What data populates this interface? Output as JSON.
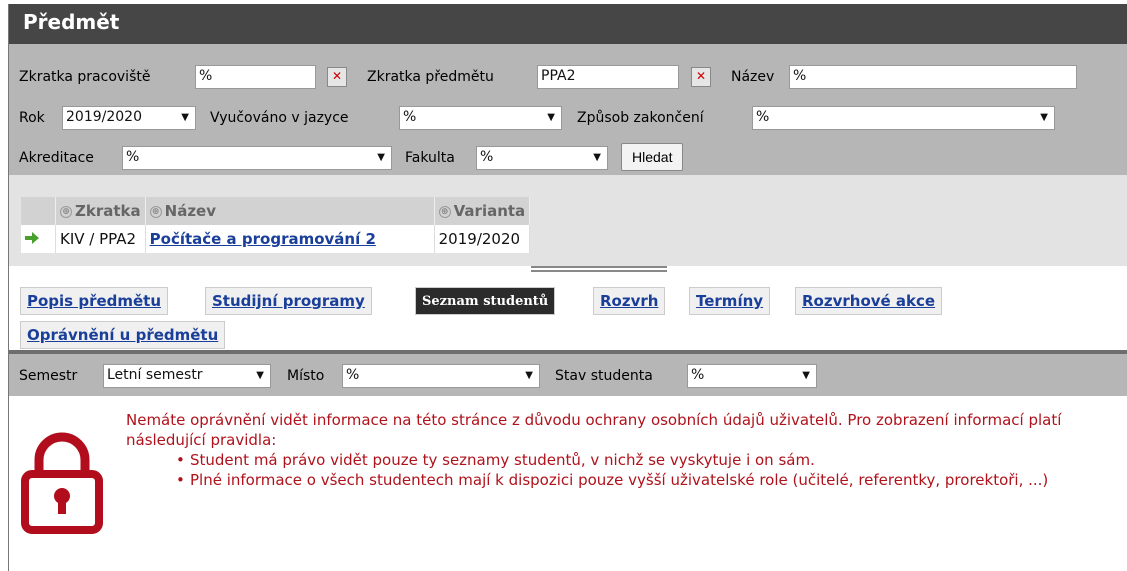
{
  "header": {
    "title": "Předmět"
  },
  "filters": {
    "zkratka_pracoviste_label": "Zkratka pracoviště",
    "zkratka_pracoviste_value": "%",
    "zkratka_predmetu_label": "Zkratka předmětu",
    "zkratka_predmetu_value": "PPA2",
    "nazev_label": "Název",
    "nazev_value": "%",
    "rok_label": "Rok",
    "rok_value": "2019/2020",
    "jazyk_label": "Vyučováno v jazyce",
    "jazyk_value": "%",
    "zakonceni_label": "Způsob zakončení",
    "zakonceni_value": "%",
    "akreditace_label": "Akreditace",
    "akreditace_value": "%",
    "fakulta_label": "Fakulta",
    "fakulta_value": "%",
    "search_button": "Hledat",
    "dropdown_arrow": "▼",
    "clear_icon": "✕"
  },
  "results": {
    "columns": [
      "Zkratka",
      "Název",
      "Varianta"
    ],
    "rows": [
      {
        "zkratka": "KIV / PPA2",
        "nazev": "Počítače a programování 2",
        "varianta": "2019/2020"
      }
    ],
    "row_marker_icon": "green-arrow-right-icon",
    "sort_icon_glyph": "⊕"
  },
  "tabs": [
    {
      "label": "Popis předmětu"
    },
    {
      "label": "Studijní programy"
    },
    {
      "label": "Seznam studentů",
      "active": true
    },
    {
      "label": "Rozvrh"
    },
    {
      "label": "Termíny"
    },
    {
      "label": "Rozvrhové akce"
    },
    {
      "label": "Oprávnění u předmětu"
    }
  ],
  "subfilter": {
    "semestr_label": "Semestr",
    "semestr_value": "Letní semestr",
    "misto_label": "Místo",
    "misto_value": "%",
    "stav_label": "Stav studenta",
    "stav_value": "%"
  },
  "message": {
    "intro": "Nemáte oprávnění vidět informace na této stránce z důvodu ochrany osobních údajů uživatelů. Pro zobrazení informací platí následující pravidla:",
    "rules": [
      "Student má právo vidět pouze ty seznamy studentů, v nichž se vyskytuje i on sám.",
      "Plné informace o všech studentech mají k dispozici pouze vyšší uživatelské role (učitelé, referentky, prorektoři, ...)"
    ],
    "icon": "lock-icon"
  },
  "colors": {
    "header_bg": "#464646",
    "filter_bg": "#b6b6b6",
    "link": "#1a3f9a",
    "error_text": "#b0121b",
    "lock": "#b10d1c",
    "row_arrow": "#4aa02c"
  }
}
